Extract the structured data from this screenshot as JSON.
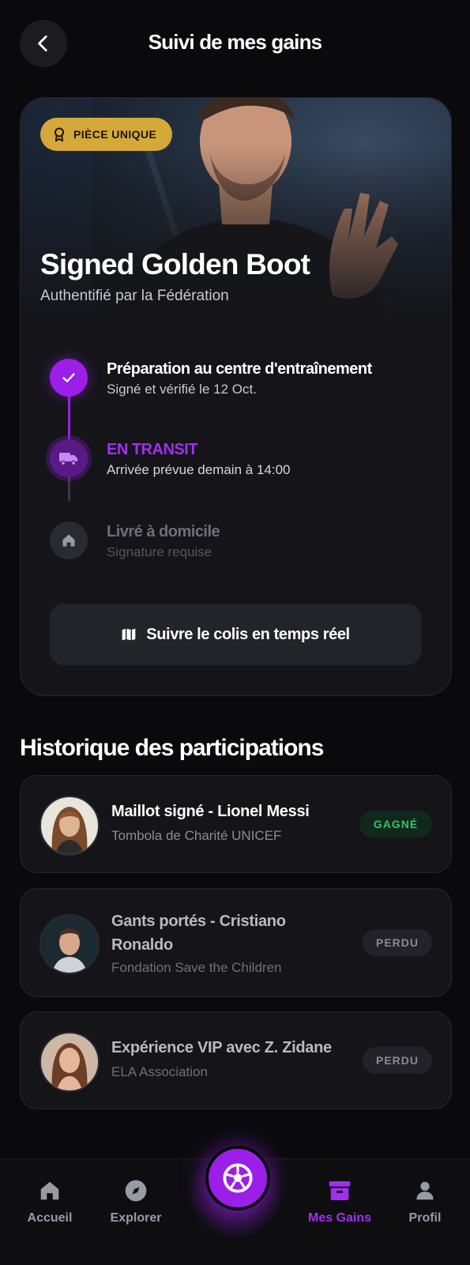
{
  "header": {
    "title": "Suivi de mes gains"
  },
  "prize": {
    "badge": "PIÈCE UNIQUE",
    "title": "Signed Golden Boot",
    "subtitle": "Authentifié par la Fédération"
  },
  "steps": [
    {
      "title": "Préparation au centre d'entraînement",
      "desc": "Signé et vérifié le 12 Oct.",
      "state": "done"
    },
    {
      "title": "EN TRANSIT",
      "desc": "Arrivée prévue demain à 14:00",
      "state": "active"
    },
    {
      "title": "Livré à domicile",
      "desc": "Signature requise",
      "state": "pending"
    }
  ],
  "track_button": "Suivre le colis en temps réel",
  "history": {
    "title": "Historique des participations",
    "entries": [
      {
        "title": "Maillot signé - Lionel Messi",
        "org": "Tombola de Charité UNICEF",
        "status": "GAGNÉ"
      },
      {
        "title_line1": "Gants portés - Cristiano",
        "title_line2": "Ronaldo",
        "org": "Fondation Save the Children",
        "status": "PERDU"
      },
      {
        "title": "Expérience VIP avec Z. Zidane",
        "org": "ELA Association",
        "status": "PERDU"
      }
    ]
  },
  "nav": {
    "items": [
      {
        "label": "Accueil",
        "icon": "home-icon"
      },
      {
        "label": "Explorer",
        "icon": "compass-icon"
      },
      {
        "label": "",
        "icon": "soccer-ball-icon"
      },
      {
        "label": "Mes Gains",
        "icon": "archive-icon"
      },
      {
        "label": "Profil",
        "icon": "person-icon"
      }
    ]
  },
  "colors": {
    "accent": "#9b1fe8",
    "gold": "#d4a93a",
    "won": "#2fc46a",
    "background": "#0a0a0c"
  }
}
